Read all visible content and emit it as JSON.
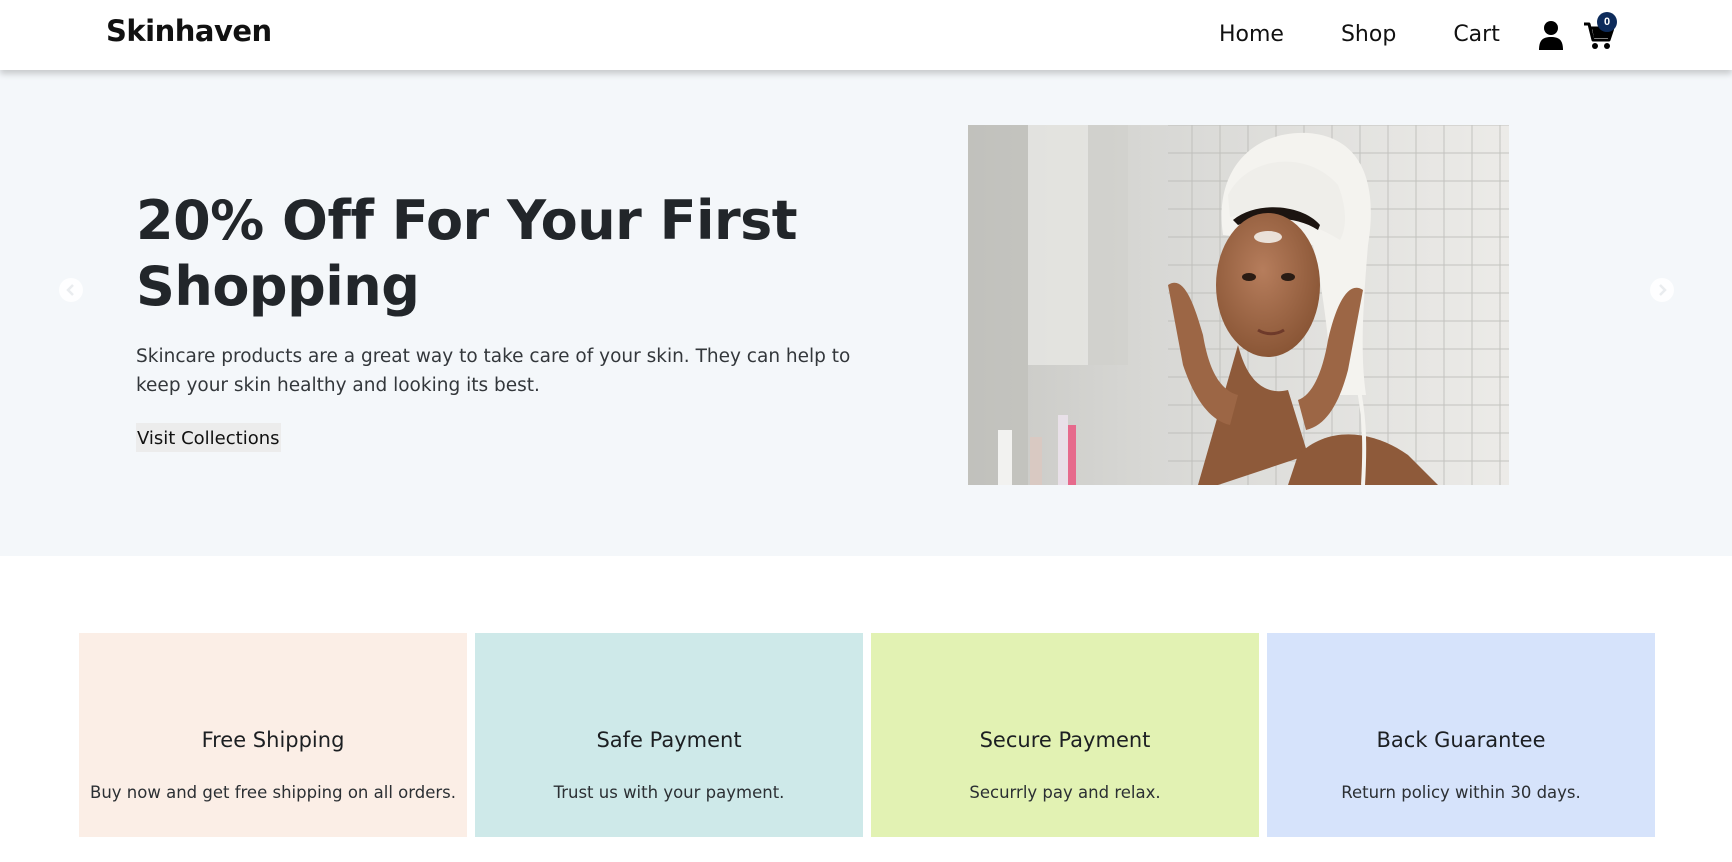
{
  "brand": "Skinhaven",
  "nav": {
    "links": [
      "Home",
      "Shop",
      "Cart"
    ],
    "cart_count": "0",
    "icons": [
      "user-icon",
      "cart-icon"
    ]
  },
  "hero": {
    "title": "20% Off For Your First Shopping",
    "description": "Skincare products are a great way to take care of your skin. They can help to keep your skin healthy and looking its best.",
    "button_label": "Visit Collections",
    "image_subject": "woman with towel on head applying face cream",
    "carousel_controls": [
      "chevron-left-icon",
      "chevron-right-icon"
    ]
  },
  "features": [
    {
      "title": "Free Shipping",
      "description": "Buy now and get free shipping on all orders.",
      "color": "#fbeee6"
    },
    {
      "title": "Safe Payment",
      "description": "Trust us with your payment.",
      "color": "#cee9e9"
    },
    {
      "title": "Secure Payment",
      "description": "Securrly pay and relax.",
      "color": "#e2f2b3"
    },
    {
      "title": "Back Guarantee",
      "description": "Return policy within 30 days.",
      "color": "#d6e3fb"
    }
  ],
  "colors": {
    "hero_background": "#f4f7fa",
    "badge": "#0d2b5b",
    "text": "#212529"
  }
}
